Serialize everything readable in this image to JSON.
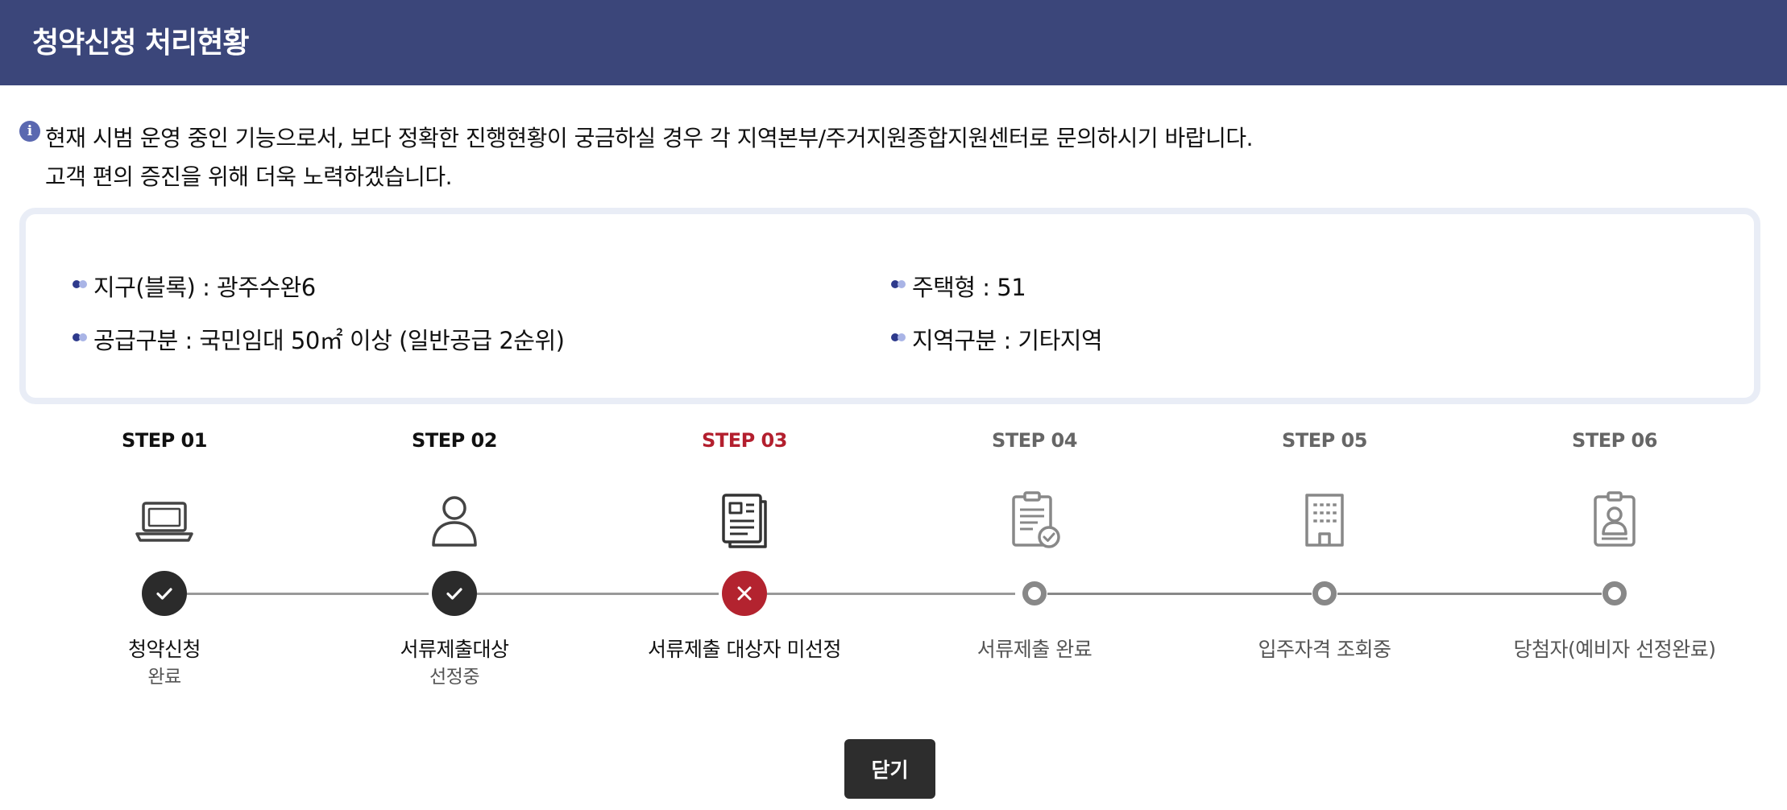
{
  "header": {
    "title": "청약신청 처리현황"
  },
  "notice": {
    "icon": "info-icon",
    "line1": "현재 시범 운영 중인 기능으로서, 보다 정확한 진행현황이 궁금하실 경우 각 지역본부/주거지원종합지원센터로 문의하시기 바랍니다.",
    "line2": "고객 편의 증진을 위해 더욱 노력하겠습니다."
  },
  "info": {
    "district": "지구(블록) : 광주수완6",
    "supply": "공급구분 : 국민임대 50㎡ 이상 (일반공급 2순위)",
    "house_type": "주택형 : 51",
    "region": "지역구분 : 기타지역"
  },
  "steps": [
    {
      "label": "STEP 01",
      "icon": "laptop-icon",
      "status": "done",
      "text1": "청약신청",
      "text2": "완료"
    },
    {
      "label": "STEP 02",
      "icon": "person-icon",
      "status": "done",
      "text1": "서류제출대상",
      "text2": "선정중"
    },
    {
      "label": "STEP 03",
      "icon": "document-icon",
      "status": "fail",
      "text1": "서류제출 대상자 미선정",
      "text2": ""
    },
    {
      "label": "STEP 04",
      "icon": "clipboard-check-icon",
      "status": "pending",
      "text1": "서류제출 완료",
      "text2": ""
    },
    {
      "label": "STEP 05",
      "icon": "building-icon",
      "status": "pending",
      "text1": "입주자격 조회중",
      "text2": ""
    },
    {
      "label": "STEP 06",
      "icon": "id-badge-icon",
      "status": "pending",
      "text1": "당첨자(예비자 선정완료)",
      "text2": ""
    }
  ],
  "colors": {
    "header_bg": "#3b467a",
    "active_step": "#b31f2e",
    "done_circle": "#2b2b2b"
  },
  "close_button": {
    "label": "닫기"
  }
}
